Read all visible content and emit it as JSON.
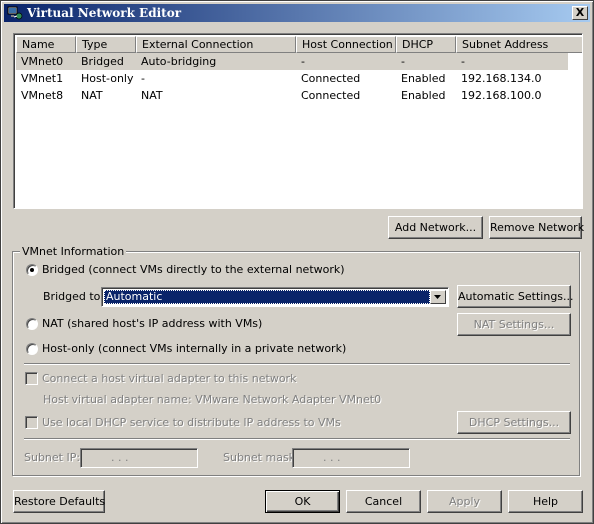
{
  "window": {
    "title": "Virtual Network Editor",
    "close_label": "X"
  },
  "table": {
    "columns": [
      "Name",
      "Type",
      "External Connection",
      "Host Connection",
      "DHCP",
      "Subnet Address"
    ],
    "rows": [
      [
        "VMnet0",
        "Bridged",
        "Auto-bridging",
        "-",
        "-",
        "-"
      ],
      [
        "VMnet1",
        "Host-only",
        "-",
        "Connected",
        "Enabled",
        "192.168.134.0"
      ],
      [
        "VMnet8",
        "NAT",
        "NAT",
        "Connected",
        "Enabled",
        "192.168.100.0"
      ]
    ],
    "selected_row": 0
  },
  "buttons": {
    "add_network": "Add Network...",
    "remove_network": "Remove Network",
    "automatic_settings": "Automatic Settings...",
    "nat_settings": "NAT Settings...",
    "dhcp_settings": "DHCP Settings...",
    "restore_defaults": "Restore Defaults",
    "ok": "OK",
    "cancel": "Cancel",
    "apply": "Apply",
    "help": "Help"
  },
  "vmnet_info": {
    "group_title": "VMnet Information",
    "bridged_label": "Bridged (connect VMs directly to the external network)",
    "bridged_to_label": "Bridged to:",
    "bridged_to_value": "Automatic",
    "nat_label": "NAT (shared host's IP address with VMs)",
    "hostonly_label": "Host-only (connect VMs internally in a private network)",
    "selected_mode": "bridged",
    "connect_adapter_label": "Connect a host virtual adapter to this network",
    "adapter_name_label": "Host virtual adapter name: VMware Network Adapter VMnet0",
    "dhcp_label": "Use local DHCP service to distribute IP address to VMs",
    "subnet_ip_label": "Subnet IP:",
    "subnet_mask_label": "Subnet mask:",
    "subnet_ip_value": ".   .   .",
    "subnet_mask_value": ".   .   ."
  }
}
